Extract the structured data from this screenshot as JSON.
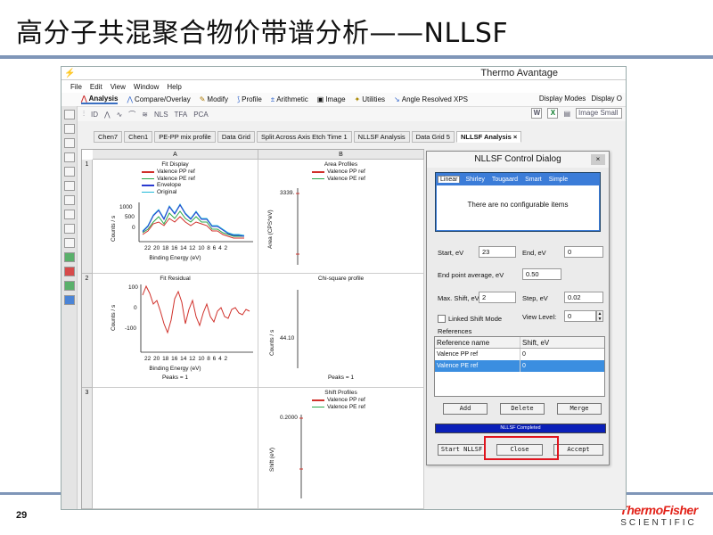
{
  "slide": {
    "title": "高分子共混聚合物价带谱分析——NLLSF",
    "page_number": "29",
    "brand_top": "ThermoFisher",
    "brand_bottom": "SCIENTIFIC"
  },
  "app": {
    "title": "Thermo Avantage",
    "menu": [
      "File",
      "Edit",
      "View",
      "Window",
      "Help"
    ],
    "ribbon_tabs": [
      "Analysis",
      "Compare/Overlay",
      "Modify",
      "Profile",
      "Arithmetic",
      "Image",
      "Utilities",
      "Angle Resolved XPS"
    ],
    "ribbon_right": [
      "Display Modes",
      "Display O"
    ],
    "toolbar_items": [
      "ID",
      "NLS",
      "TFA",
      "PCA"
    ],
    "toolbar_right": {
      "w": "W",
      "x": "X",
      "combo": "Image Small"
    },
    "doc_tabs": [
      "Chen7",
      "Chen1",
      "PE-PP mix profile",
      "Data Grid",
      "Split Across Axis Etch Time 1",
      "NLLSF Analysis",
      "Data Grid 5",
      "NLLSF Analysis"
    ],
    "doc_tab_close": "×"
  },
  "grid": {
    "columns": [
      "A",
      "B"
    ],
    "rows": [
      "1",
      "2",
      "3"
    ],
    "fit_display": {
      "title": "Fit Display",
      "legend": [
        {
          "label": "Valence PP ref",
          "color": "#d0302a"
        },
        {
          "label": "Valence PE ref",
          "color": "#2aa84a"
        },
        {
          "label": "Envelope",
          "color": "#2a3ad0"
        },
        {
          "label": "Original",
          "color": "#20b8d8"
        }
      ],
      "y_ticks": [
        "1000",
        "500",
        "0"
      ],
      "x_ticks": "22 20 18 16 14 12 10 8 6 4 2",
      "ylabel": "Counts / s",
      "xlabel": "Binding Energy (eV)"
    },
    "area_profiles": {
      "title": "Area Profiles",
      "legend": [
        {
          "label": "Valence PP ref",
          "color": "#d0302a"
        },
        {
          "label": "Valence PE ref",
          "color": "#2aa84a"
        }
      ],
      "y_tick": "3339.",
      "ylabel": "Area (CPS*eV)"
    },
    "fit_residual": {
      "title": "Fit Residual",
      "y_ticks": [
        "100",
        "0",
        "-100"
      ],
      "x_ticks": "22 20 18 16 14 12 10 8 6 4 2",
      "ylabel": "Counts / s",
      "xlabel": "Binding Energy (eV)",
      "peaks": "Peaks = 1"
    },
    "chi_square": {
      "title": "Chi-square profile",
      "y_tick": "44.10",
      "ylabel": "Counts / s",
      "peaks": "Peaks = 1"
    },
    "shift_profiles": {
      "title": "Shift Profiles",
      "legend": [
        {
          "label": "Valence PP ref",
          "color": "#d0302a"
        },
        {
          "label": "Valence PE ref",
          "color": "#2aa84a"
        }
      ],
      "y_tick": "0.2000",
      "ylabel": "Shift (eV)"
    }
  },
  "dialog": {
    "title": "NLLSF Control Dialog",
    "close": "×",
    "tabs": [
      "Linear",
      "Shirley",
      "Tougaard",
      "Smart",
      "Simple"
    ],
    "tab_message": "There are no configurable items",
    "start_label": "Start, eV",
    "start_value": "23",
    "end_label": "End, eV",
    "end_value": "0",
    "endpoint_label": "End point average, eV",
    "endpoint_value": "0.50",
    "max_shift_label": "Max. Shift, eV",
    "max_shift_value": "2",
    "step_label": "Step, eV",
    "step_value": "0.02",
    "linked_label": "Linked Shift Mode",
    "view_level_label": "View Level:",
    "view_level_value": "0",
    "references_label": "References",
    "ref_headers": [
      "Reference name",
      "Shift, eV"
    ],
    "ref_rows": [
      {
        "name": "Valence PP ref",
        "shift": "0"
      },
      {
        "name": "Valence PE ref",
        "shift": "0"
      }
    ],
    "add": "Add",
    "delete": "Delete",
    "merge": "Merge",
    "progress_text": "NLLSF Completed",
    "start_nllsf": "Start NLLSF",
    "close_btn": "Close",
    "accept": "Accept"
  }
}
